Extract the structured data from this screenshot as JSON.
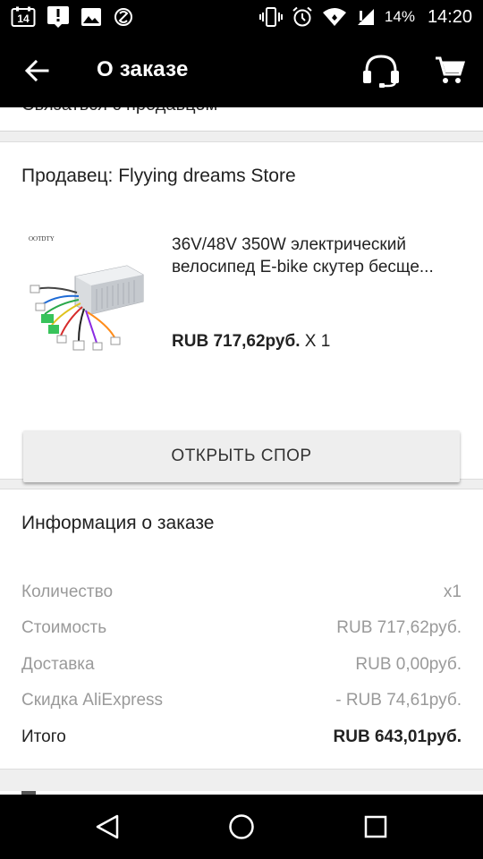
{
  "status_bar": {
    "notification_icons": [
      "calendar-14-icon",
      "download-notice-icon",
      "image-icon",
      "app-notice-icon"
    ],
    "calendar_day": "14",
    "system_icons": [
      "vibrate-icon",
      "alarm-icon",
      "wifi-icon",
      "signal-icon",
      "battery-icon"
    ],
    "battery": "14%",
    "time": "14:20"
  },
  "toolbar": {
    "title": "О заказе",
    "icons": [
      "back-arrow-icon",
      "headset-icon",
      "cart-icon"
    ]
  },
  "top_card": {
    "clipped_text": "Связаться с продавцом"
  },
  "seller": {
    "label": "Продавец: Flyying dreams Store"
  },
  "product": {
    "title_line1": "36V/48V 350W электрический",
    "title_line2": "велосипед E-bike скутер бесще...",
    "price": "RUB 717,62руб.",
    "quantity": " X 1",
    "image_brand": "OOTDTY"
  },
  "dispute_button": {
    "label": "ОТКРЫТЬ СПОР"
  },
  "order_info": {
    "title": "Информация о заказе",
    "rows": [
      {
        "label": "Количество",
        "value": "x1"
      },
      {
        "label": "Стоимость",
        "value": "RUB 717,62руб."
      },
      {
        "label": "Доставка",
        "value": "RUB 0,00руб."
      },
      {
        "label": "Скидка AliExpress",
        "value": "- RUB 74,61руб."
      },
      {
        "label": "Итого",
        "value": "RUB 643,01руб."
      }
    ]
  },
  "nav_bar": {
    "icons": [
      "nav-back-icon",
      "nav-home-icon",
      "nav-recents-icon"
    ]
  }
}
